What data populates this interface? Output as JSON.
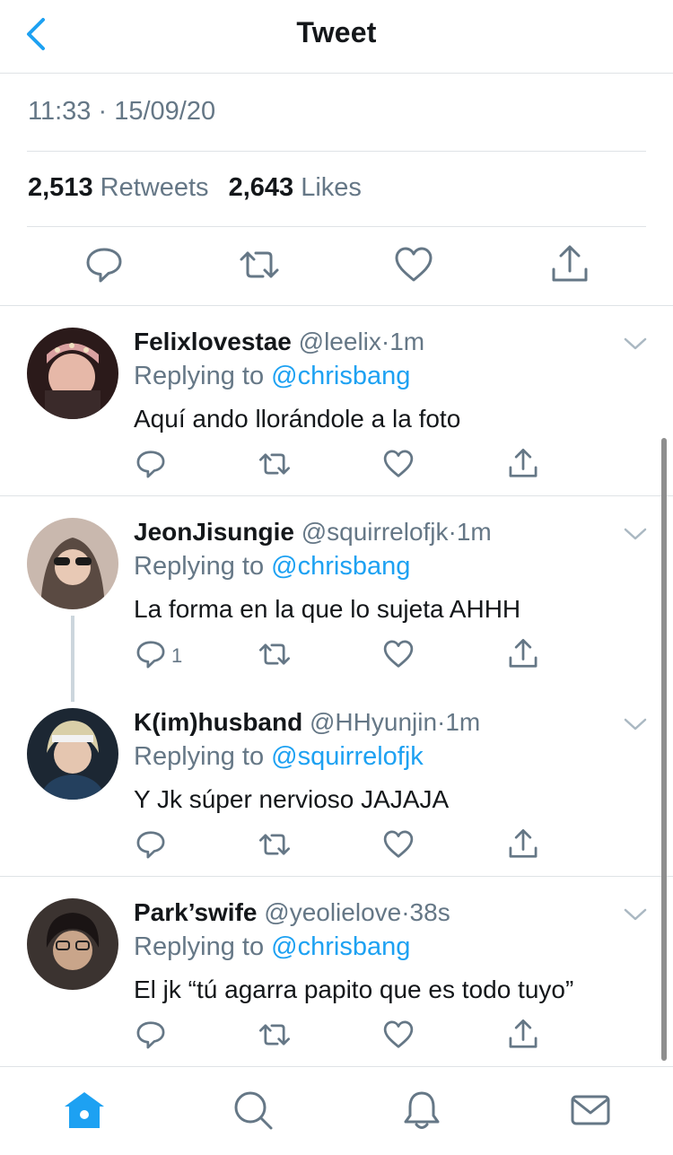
{
  "header": {
    "title": "Tweet",
    "back_icon": "chevron-left-icon"
  },
  "tweet": {
    "timestamp": "11:33 · 15/09/20",
    "retweets_count": "2,513",
    "retweets_label": "Retweets",
    "likes_count": "2,643",
    "likes_label": "Likes"
  },
  "colors": {
    "accent": "#1da1f2",
    "secondary_text": "#657786",
    "divider": "#dfe3e6"
  },
  "replies": [
    {
      "name": "Felixlovestae",
      "handle": "@leelix",
      "time": "1m",
      "replying_label": "Replying to",
      "replying_to": "@chrisbang",
      "text": "Aquí ando llorándole a la foto",
      "reply_count": ""
    },
    {
      "name": "JeonJisungie",
      "handle": "@squirrelofjk",
      "time": "1m",
      "replying_label": "Replying to",
      "replying_to": "@chrisbang",
      "text": "La forma en la que lo sujeta AHHH",
      "reply_count": "1"
    },
    {
      "name": "K(im)husband",
      "handle": "@HHyunjin",
      "time": "1m",
      "replying_label": "Replying to",
      "replying_to": "@squirrelofjk",
      "text": "Y Jk súper nervioso JAJAJA",
      "reply_count": ""
    },
    {
      "name": "Park’swife",
      "handle": "@yeolielove",
      "time": "38s",
      "replying_label": "Replying to",
      "replying_to": "@chrisbang",
      "text": "El jk “tú agarra papito que es todo tuyo”",
      "reply_count": ""
    }
  ],
  "tabbar": {
    "items": [
      "home-icon",
      "search-icon",
      "notifications-icon",
      "messages-icon"
    ],
    "active": "home-icon"
  }
}
